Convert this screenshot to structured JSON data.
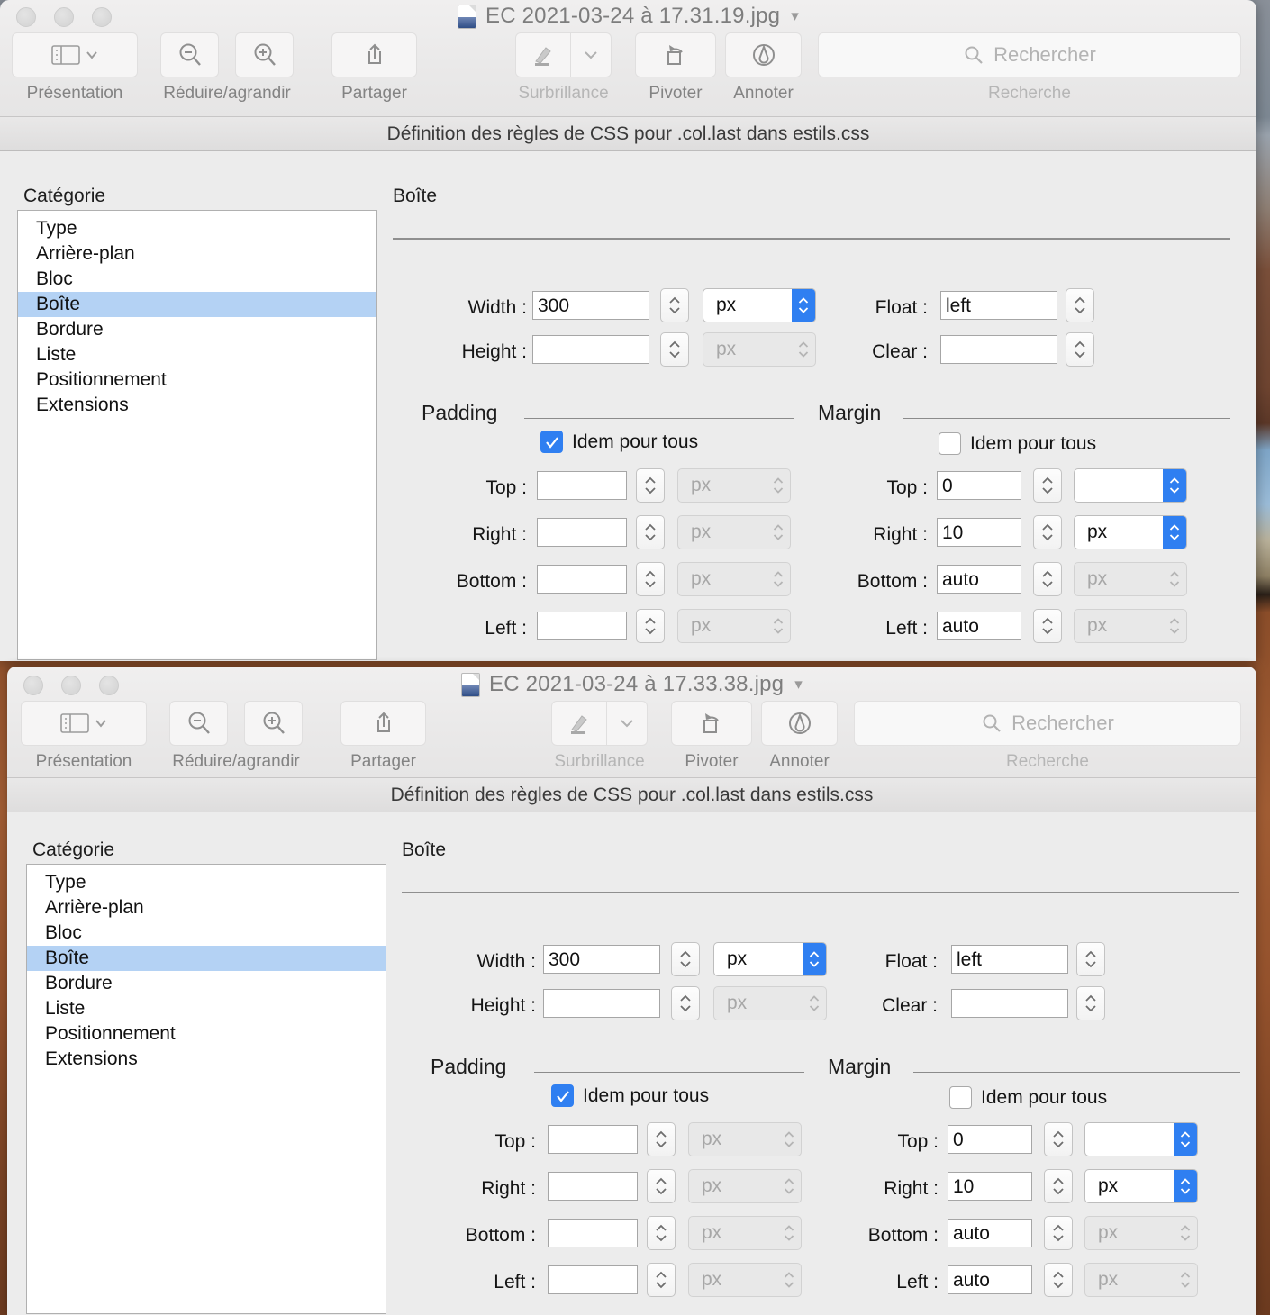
{
  "windows": [
    {
      "title": "EC 2021-03-24 à 17.31.19.jpg",
      "toolbar": {
        "presentation_label": "Présentation",
        "zoom_label": "Réduire/agrandir",
        "share_label": "Partager",
        "highlight_label": "Surbrillance",
        "rotate_label": "Pivoter",
        "annotate_label": "Annoter",
        "search_group_label": "Recherche",
        "search_placeholder": "Rechercher"
      },
      "dialog": {
        "title": "Définition des règles de CSS pour .col.last dans estils.css",
        "category_label": "Catégorie",
        "categories": [
          "Type",
          "Arrière-plan",
          "Bloc",
          "Boîte",
          "Bordure",
          "Liste",
          "Positionnement",
          "Extensions"
        ],
        "selected_category": "Boîte",
        "panel_title": "Boîte",
        "fields": {
          "width_label": "Width :",
          "width_value": "300",
          "width_unit": "px",
          "height_label": "Height :",
          "height_value": "",
          "height_unit": "px",
          "float_label": "Float :",
          "float_value": "left",
          "clear_label": "Clear :",
          "clear_value": ""
        },
        "padding": {
          "group_label": "Padding",
          "same_all_label": "Idem pour tous",
          "same_all_checked": true,
          "rows": [
            {
              "label": "Top :",
              "value": "",
              "unit": "px"
            },
            {
              "label": "Right :",
              "value": "",
              "unit": "px"
            },
            {
              "label": "Bottom :",
              "value": "",
              "unit": "px"
            },
            {
              "label": "Left :",
              "value": "",
              "unit": "px"
            }
          ]
        },
        "margin": {
          "group_label": "Margin",
          "same_all_label": "Idem pour tous",
          "same_all_checked": false,
          "rows": [
            {
              "label": "Top :",
              "value": "0",
              "unit": "",
              "unit_active": true
            },
            {
              "label": "Right :",
              "value": "10",
              "unit": "px",
              "unit_active": true
            },
            {
              "label": "Bottom :",
              "value": "auto",
              "unit": "px",
              "unit_active": false
            },
            {
              "label": "Left :",
              "value": "auto",
              "unit": "px",
              "unit_active": false
            }
          ]
        }
      }
    },
    {
      "title": "EC 2021-03-24 à 17.33.38.jpg",
      "toolbar": {
        "presentation_label": "Présentation",
        "zoom_label": "Réduire/agrandir",
        "share_label": "Partager",
        "highlight_label": "Surbrillance",
        "rotate_label": "Pivoter",
        "annotate_label": "Annoter",
        "search_group_label": "Recherche",
        "search_placeholder": "Rechercher"
      },
      "dialog": {
        "title": "Définition des règles de CSS pour .col.last dans estils.css",
        "category_label": "Catégorie",
        "categories": [
          "Type",
          "Arrière-plan",
          "Bloc",
          "Boîte",
          "Bordure",
          "Liste",
          "Positionnement",
          "Extensions"
        ],
        "selected_category": "Boîte",
        "panel_title": "Boîte",
        "fields": {
          "width_label": "Width :",
          "width_value": "300",
          "width_unit": "px",
          "height_label": "Height :",
          "height_value": "",
          "height_unit": "px",
          "float_label": "Float :",
          "float_value": "left",
          "clear_label": "Clear :",
          "clear_value": ""
        },
        "padding": {
          "group_label": "Padding",
          "same_all_label": "Idem pour tous",
          "same_all_checked": true,
          "rows": [
            {
              "label": "Top :",
              "value": "",
              "unit": "px"
            },
            {
              "label": "Right :",
              "value": "",
              "unit": "px"
            },
            {
              "label": "Bottom :",
              "value": "",
              "unit": "px"
            },
            {
              "label": "Left :",
              "value": "",
              "unit": "px"
            }
          ]
        },
        "margin": {
          "group_label": "Margin",
          "same_all_label": "Idem pour tous",
          "same_all_checked": false,
          "rows": [
            {
              "label": "Top :",
              "value": "0",
              "unit": "",
              "unit_active": true
            },
            {
              "label": "Right :",
              "value": "10",
              "unit": "px",
              "unit_active": true
            },
            {
              "label": "Bottom :",
              "value": "auto",
              "unit": "px",
              "unit_active": false
            },
            {
              "label": "Left :",
              "value": "auto",
              "unit": "px",
              "unit_active": false
            }
          ]
        }
      }
    }
  ],
  "colors": {
    "accent_blue": "#2f7ff1",
    "selection_blue": "#b4d2f4",
    "chrome_gray": "#ececec"
  }
}
